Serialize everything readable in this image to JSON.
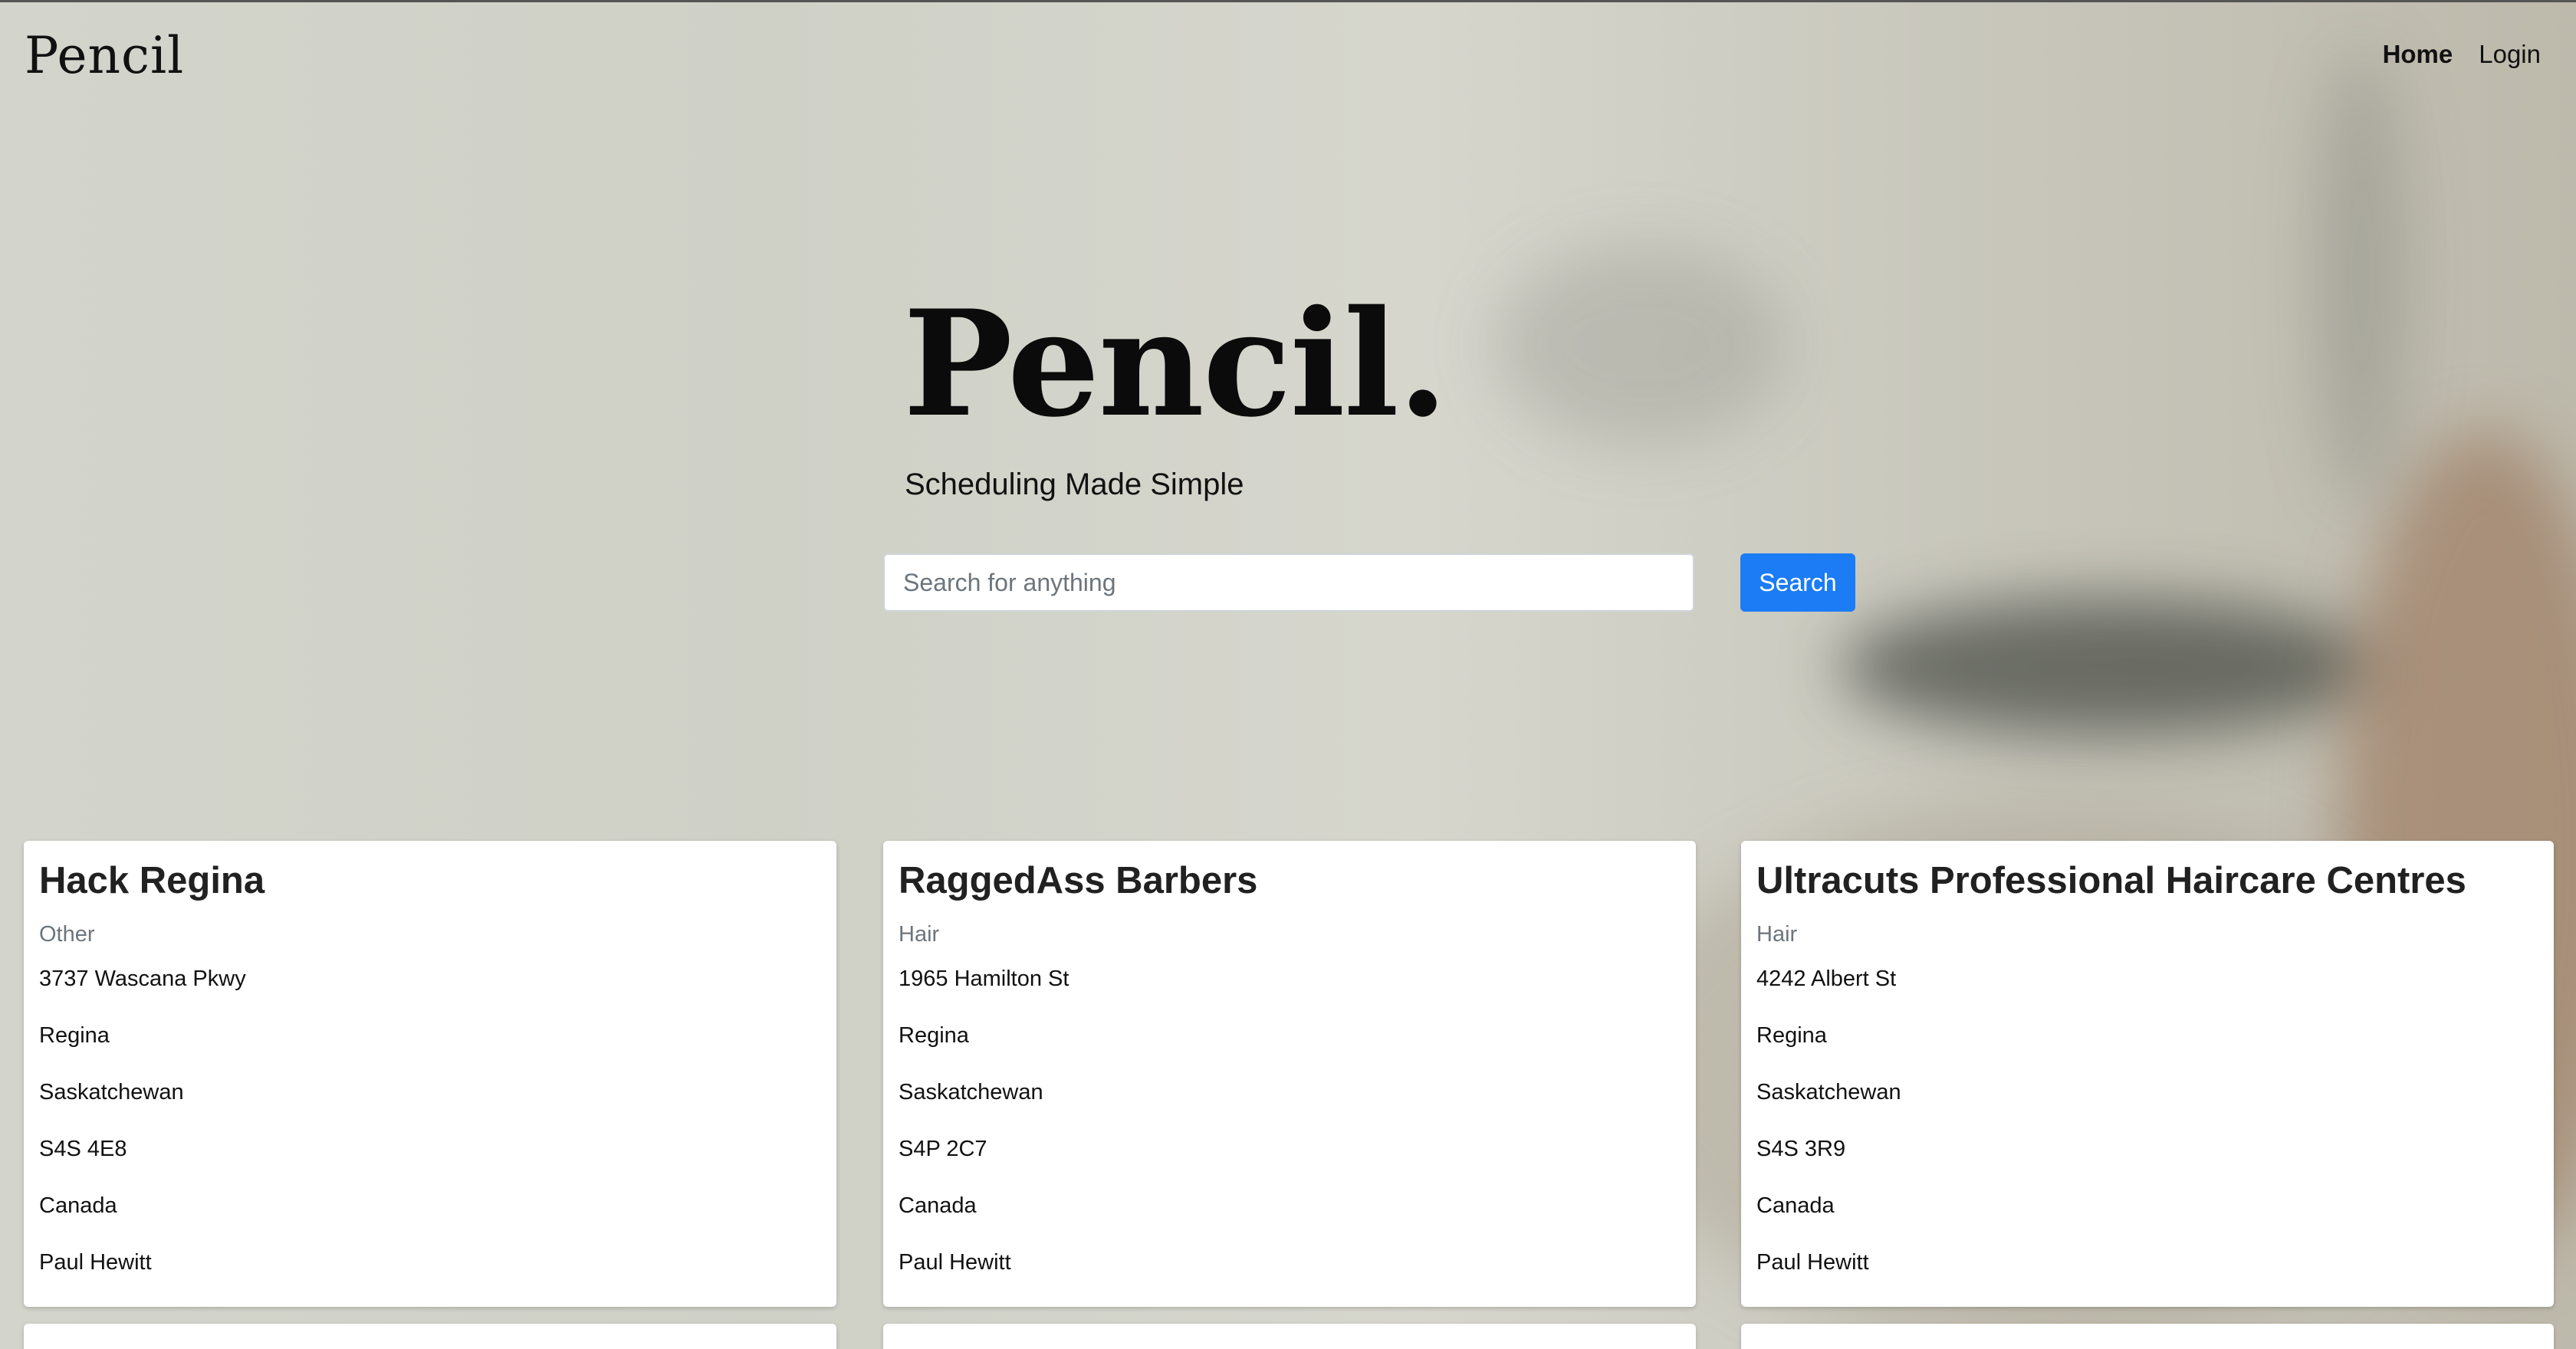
{
  "nav": {
    "brand": "Pencil",
    "links": [
      {
        "label": "Home",
        "active": true
      },
      {
        "label": "Login",
        "active": false
      }
    ]
  },
  "hero": {
    "title": "Pencil.",
    "subtitle": "Scheduling Made Simple"
  },
  "search": {
    "placeholder": "Search for anything",
    "button_label": "Search"
  },
  "colors": {
    "accent": "#1b7cf5",
    "card_bg": "#ffffff",
    "muted_text": "#6c757d"
  },
  "businesses": [
    {
      "name": "Hack Regina",
      "category": "Other",
      "street": "3737 Wascana Pkwy",
      "city": "Regina",
      "province": "Saskatchewan",
      "postal": "S4S 4E8",
      "country": "Canada",
      "owner": "Paul Hewitt"
    },
    {
      "name": "RaggedAss Barbers",
      "category": "Hair",
      "street": "1965 Hamilton St",
      "city": "Regina",
      "province": "Saskatchewan",
      "postal": "S4P 2C7",
      "country": "Canada",
      "owner": "Paul Hewitt"
    },
    {
      "name": "Ultracuts Professional Haircare Centres",
      "category": "Hair",
      "street": "4242 Albert St",
      "city": "Regina",
      "province": "Saskatchewan",
      "postal": "S4S 3R9",
      "country": "Canada",
      "owner": "Paul Hewitt"
    }
  ]
}
